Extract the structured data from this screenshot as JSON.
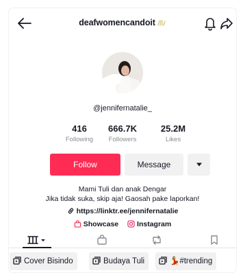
{
  "header": {
    "username": "deafwomencandoit",
    "icons": [
      "back-arrow-icon",
      "hands-badge-icon",
      "bell-icon",
      "share-icon"
    ]
  },
  "profile": {
    "handle": "@jennifernatalie_"
  },
  "stats": [
    {
      "value": "416",
      "label": "Following"
    },
    {
      "value": "666.7K",
      "label": "Followers"
    },
    {
      "value": "25.2M",
      "label": "Likes"
    }
  ],
  "actions": {
    "follow": "Follow",
    "message": "Message"
  },
  "bio": {
    "line1": "Mami Tuli dan anak Dengar",
    "line2": "Jika tidak suka, skip aja! Gaosah pake laporkan!",
    "link": "https://linktr.ee/jennifernatalie"
  },
  "chips": {
    "showcase": "Showcase",
    "instagram": "Instagram"
  },
  "playlists": [
    {
      "label": "Cover Bisindo"
    },
    {
      "label": "Budaya Tuli"
    },
    {
      "label": "💃#trending"
    }
  ],
  "colors": {
    "accent": "#fe2c55",
    "text": "#161823",
    "muted": "#8a8b91",
    "button_bg": "#f1f1f2"
  }
}
